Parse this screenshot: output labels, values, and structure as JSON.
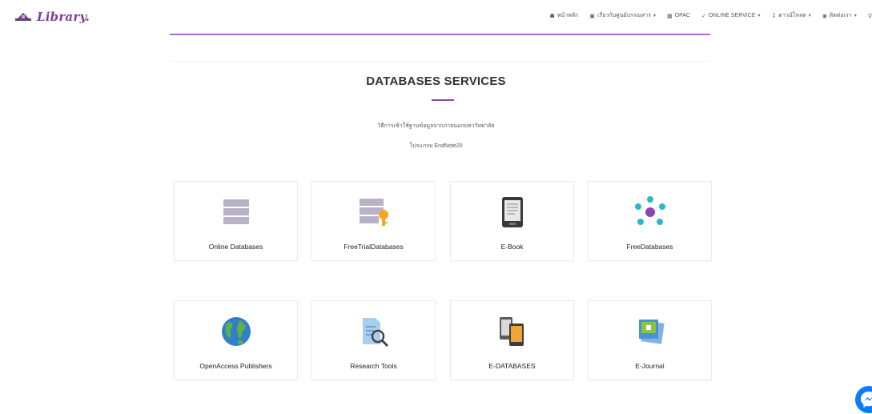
{
  "brand": {
    "name": "Library.",
    "logo_icon": "library-logo"
  },
  "nav": {
    "items": [
      {
        "label": "หน้าหลัก",
        "icon": "home-icon",
        "has_dropdown": false
      },
      {
        "label": "เกี่ยวกับศูนย์บรรณสาร",
        "icon": "building-icon",
        "has_dropdown": true
      },
      {
        "label": "OPAC",
        "icon": "book-icon",
        "has_dropdown": false
      },
      {
        "label": "ONLINE SERVICE",
        "icon": "bolt-icon",
        "has_dropdown": true
      },
      {
        "label": "ดาวน์โหลด",
        "icon": "download-icon",
        "has_dropdown": true
      },
      {
        "label": "ติดต่อเรา",
        "icon": "chat-icon",
        "has_dropdown": true
      }
    ]
  },
  "section": {
    "title": "DATABASES SERVICES",
    "subtitle_1": "วิธีการเข้าใช้ฐานข้อมูลจากภายนอกมหาวิทยาลัย",
    "subtitle_2": "โปรแกรม EndNote20"
  },
  "cards": [
    {
      "label": "Online Databases",
      "icon": "database-icon"
    },
    {
      "label": "FreeTrialDatabases",
      "icon": "database-key-icon"
    },
    {
      "label": "E-Book",
      "icon": "ebook-reader-icon"
    },
    {
      "label": "FreeDatabases",
      "icon": "network-icon"
    },
    {
      "label": "OpenAccess Publishers",
      "icon": "globe-icon"
    },
    {
      "label": "Research Tools",
      "icon": "document-search-icon"
    },
    {
      "label": "E-DATABASES",
      "icon": "devices-icon"
    },
    {
      "label": "E-Journal",
      "icon": "photo-journal-icon"
    }
  ],
  "colors": {
    "accent": "#8e44ad",
    "brand": "#7b3f98",
    "messenger": "#0a7cff"
  }
}
